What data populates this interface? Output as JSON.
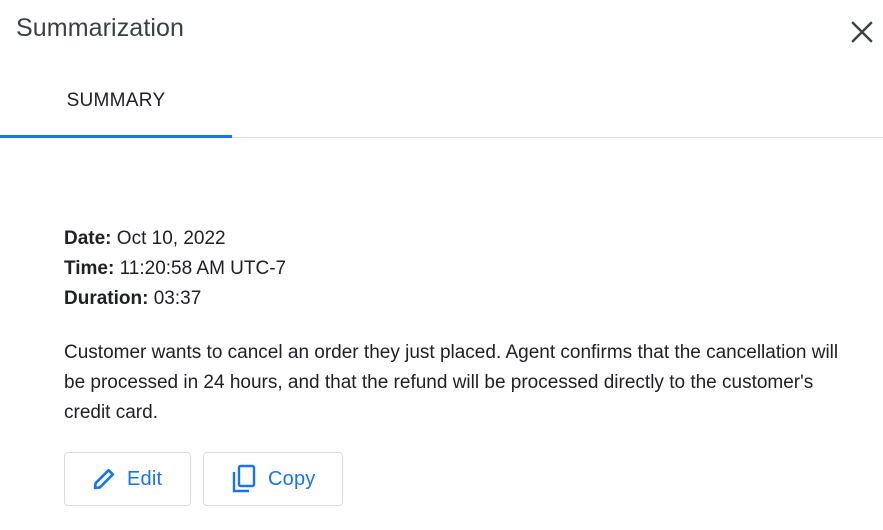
{
  "header": {
    "title": "Summarization",
    "close_icon": "close-icon"
  },
  "tabs": [
    {
      "label": "SUMMARY",
      "active": true
    }
  ],
  "details": {
    "date_label": "Date:",
    "date_value": "Oct 10, 2022",
    "time_label": "Time:",
    "time_value": "11:20:58 AM UTC-7",
    "duration_label": "Duration:",
    "duration_value": "03:37"
  },
  "summary": {
    "text": "Customer wants to cancel an order they just placed. Agent confirms that the cancellation will be processed in 24 hours, and that the refund will be processed directly to the customer's credit card."
  },
  "actions": {
    "edit_label": "Edit",
    "edit_icon": "pencil-icon",
    "copy_label": "Copy",
    "copy_icon": "copy-icon"
  },
  "colors": {
    "accent": "#1a73e8",
    "text": "#202124",
    "divider": "#dadce0"
  }
}
